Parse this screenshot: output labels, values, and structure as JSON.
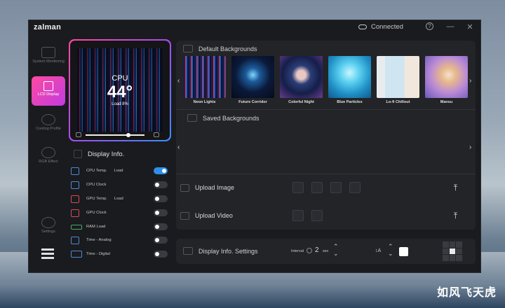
{
  "app": {
    "logo": "zalman",
    "status": "Connected",
    "help_label": "?",
    "minimize_label": "—",
    "close_label": "✕"
  },
  "sidebar": {
    "items": [
      {
        "label": "System Monitoring",
        "icon": "monitor-icon"
      },
      {
        "label": "LCD Display",
        "icon": "lcd-icon",
        "active": true
      },
      {
        "label": "Cooling Profile",
        "icon": "fan-icon"
      },
      {
        "label": "RGB Effect",
        "icon": "sun-icon"
      },
      {
        "label": "Settings",
        "icon": "gear-icon"
      }
    ]
  },
  "preview": {
    "label": "CPU",
    "value": "44°",
    "sub": "Load   8%"
  },
  "display_info": {
    "title": "Display Info.",
    "rows": [
      {
        "label": "CPU Temp.",
        "extra": "Load",
        "on": true
      },
      {
        "label": "CPU Clock",
        "extra": "",
        "on": false
      },
      {
        "label": "GPU Temp.",
        "extra": "Load",
        "on": false
      },
      {
        "label": "GPU Clock",
        "extra": "",
        "on": false
      },
      {
        "label": "RAM Load",
        "extra": "",
        "on": false
      },
      {
        "label": "Time - Analog",
        "extra": "",
        "on": false
      },
      {
        "label": "Time - Digital",
        "extra": "",
        "on": false
      }
    ]
  },
  "backgrounds": {
    "default_title": "Default Backgrounds",
    "saved_title": "Saved Backgrounds",
    "thumbs": [
      {
        "name": "Neon Lights"
      },
      {
        "name": "Future Corridor"
      },
      {
        "name": "Colorful Night"
      },
      {
        "name": "Blue Particles"
      },
      {
        "name": "Lo-fi Chillout"
      },
      {
        "name": "Mansu"
      }
    ],
    "arrow_left": "‹",
    "arrow_right": "›"
  },
  "upload": {
    "image_label": "Upload Image",
    "video_label": "Upload Video",
    "upload_arrow": "⤒"
  },
  "settings_bar": {
    "title": "Display Info. Settings",
    "interval_label": "Interval",
    "interval_value": "2",
    "interval_unit": "sec",
    "font_label": "↕A",
    "stepper_up": "⌃",
    "stepper_down": "⌄"
  },
  "watermark": "如风飞天虎",
  "colors": {
    "accent_blue": "#2f8ee8",
    "active_pink": "#ff4aa0",
    "active_purple": "#c13be0"
  }
}
